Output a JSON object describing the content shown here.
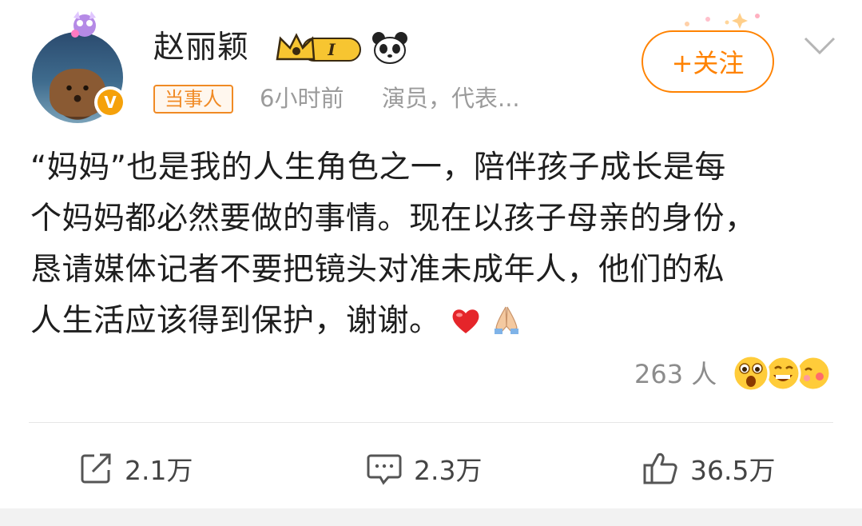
{
  "post": {
    "author": {
      "name": "赵丽颖",
      "vip_level": "I",
      "tag": "当事人",
      "time": "6小时前",
      "description": "演员，代表..."
    },
    "follow_label": "+关注",
    "content_lines": [
      "“妈妈”也是我的人生角色之一，陪伴孩子成长是每",
      "个妈妈都必然要做的事情。现在以孩子母亲的身份，",
      "恳请媒体记者不要把镜头对准未成年人，他们的私",
      "人生活应该得到保护，谢谢。"
    ],
    "reactions": {
      "count_label": "263 人",
      "emoji_names": [
        "shocked-face",
        "grinning-face",
        "kissing-face"
      ]
    }
  },
  "actions": {
    "repost": "2.1万",
    "comment": "2.3万",
    "like": "36.5万"
  },
  "colors": {
    "accent": "#ff8200",
    "tag_orange": "#f08a24",
    "meta_gray": "#9b9b9b"
  }
}
